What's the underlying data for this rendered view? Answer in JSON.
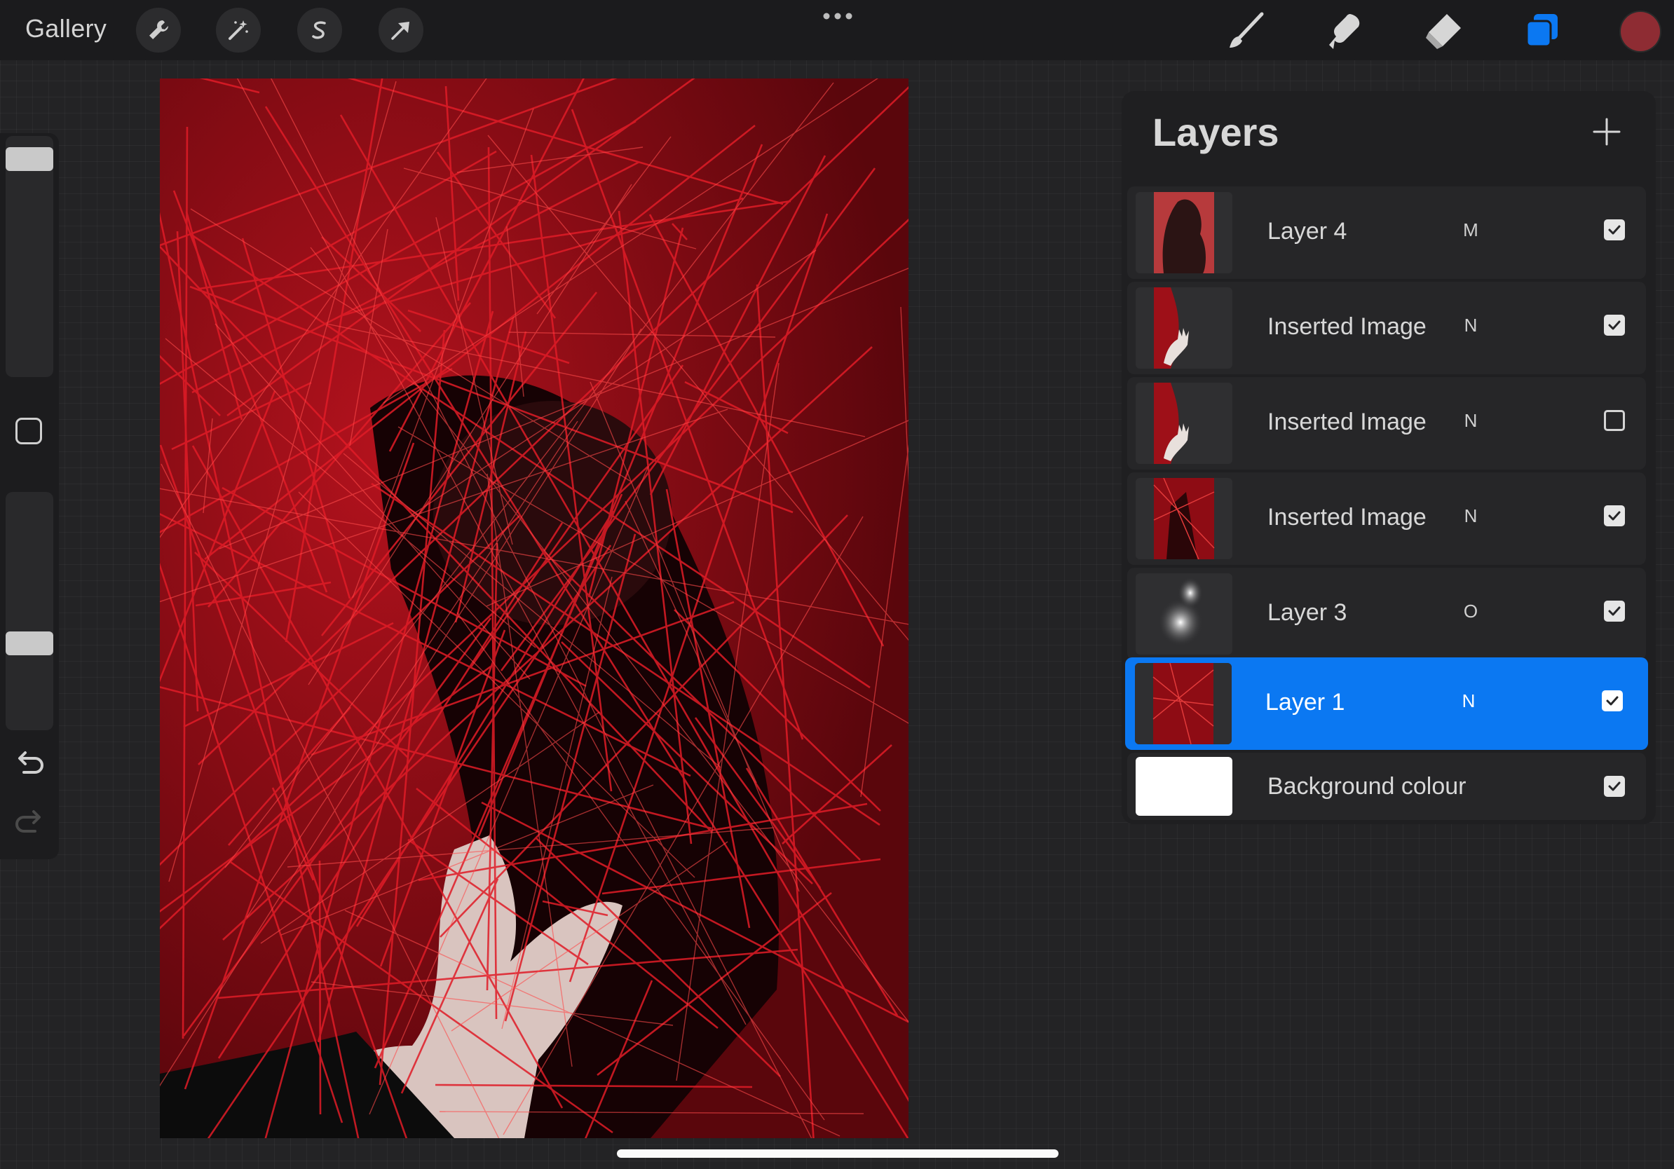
{
  "topbar": {
    "gallery_label": "Gallery",
    "left_tools": [
      "wrench-icon",
      "magic-wand-icon",
      "selection-s-icon",
      "transform-arrow-icon"
    ],
    "right_tools": [
      "brush-icon",
      "smudge-icon",
      "eraser-icon",
      "layers-icon"
    ],
    "active_tool": "layers-icon",
    "current_color": "#8e2c33",
    "accent_color": "#0b78f2"
  },
  "sidebar": {
    "brush_size_level": 0.95,
    "opacity_level": 0.35
  },
  "layers_panel": {
    "title": "Layers",
    "add_icon": "plus-icon",
    "layers": [
      {
        "name": "Layer 4",
        "blend": "M",
        "visible": true,
        "selected": false
      },
      {
        "name": "Inserted Image",
        "blend": "N",
        "visible": true,
        "selected": false
      },
      {
        "name": "Inserted Image",
        "blend": "N",
        "visible": false,
        "selected": false
      },
      {
        "name": "Inserted Image",
        "blend": "N",
        "visible": true,
        "selected": false
      },
      {
        "name": "Layer 3",
        "blend": "O",
        "visible": true,
        "selected": false
      },
      {
        "name": "Layer 1",
        "blend": "N",
        "visible": true,
        "selected": true
      },
      {
        "name": "Background colour",
        "blend": "",
        "visible": true,
        "selected": false
      }
    ]
  }
}
